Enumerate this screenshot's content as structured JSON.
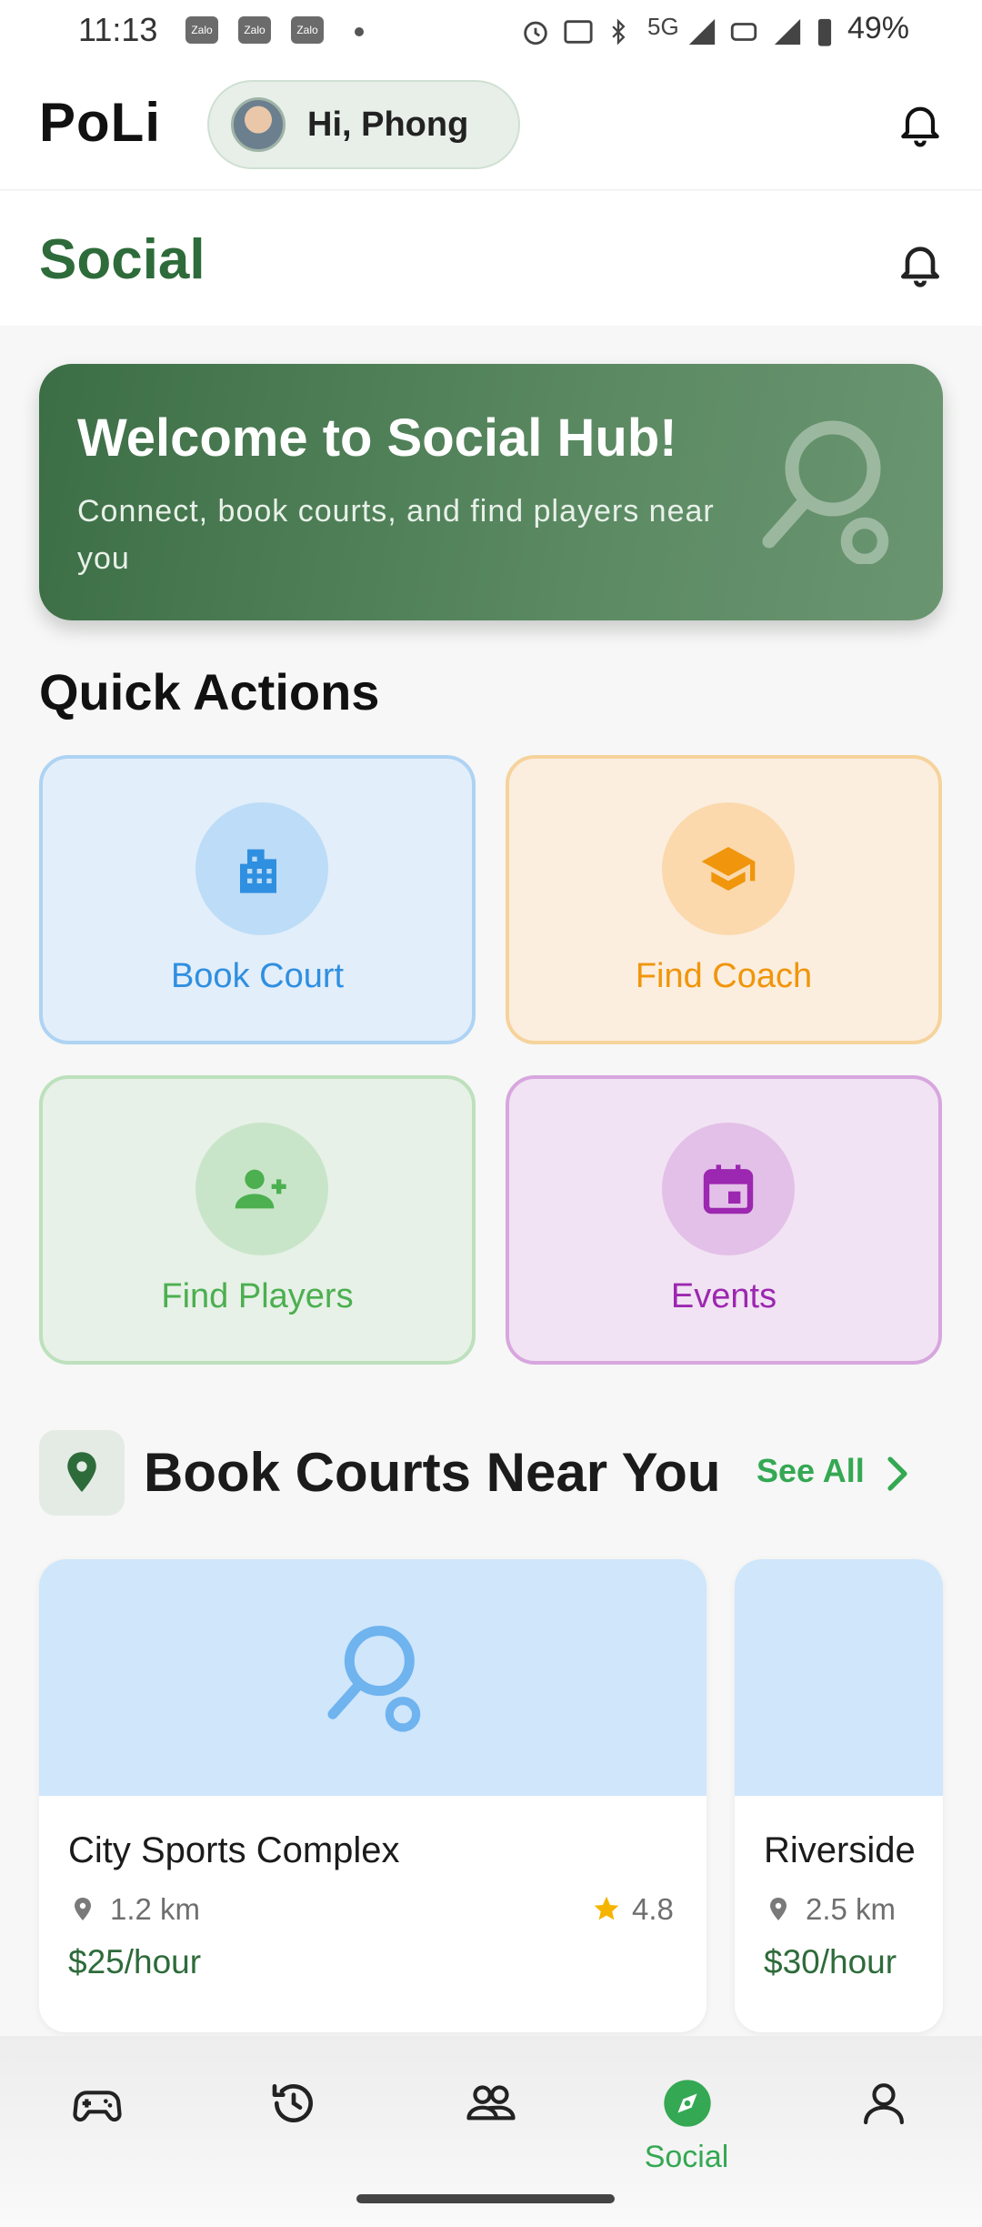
{
  "status_bar": {
    "time": "11:13",
    "notification_icons": [
      "Zalo",
      "Zalo",
      "Zalo"
    ],
    "battery": "49%",
    "network": "5G"
  },
  "header": {
    "logo": "PoLi",
    "greeting": "Hi, Phong"
  },
  "section": {
    "title": "Social"
  },
  "hero": {
    "title": "Welcome to Social Hub!",
    "subtitle": "Connect, book courts, and find players near you"
  },
  "quick_actions": {
    "title": "Quick Actions",
    "items": [
      {
        "label": "Book Court",
        "icon": "building-icon",
        "color": "#2f8fe0"
      },
      {
        "label": "Find Coach",
        "icon": "graduation-cap-icon",
        "color": "#f0950c"
      },
      {
        "label": "Find Players",
        "icon": "add-person-icon",
        "color": "#4caf50"
      },
      {
        "label": "Events",
        "icon": "calendar-icon",
        "color": "#9c27b0"
      }
    ]
  },
  "courts": {
    "title": "Book Courts Near You",
    "see_all": "See All",
    "items": [
      {
        "name": "City Sports Complex",
        "distance": "1.2 km",
        "rating": "4.8",
        "price": "$25/hour"
      },
      {
        "name": "Riverside",
        "distance": "2.5 km",
        "price": "$30/hour"
      }
    ]
  },
  "bottom_nav": {
    "items": [
      {
        "icon": "gamepad-icon"
      },
      {
        "icon": "history-icon"
      },
      {
        "icon": "people-icon"
      },
      {
        "icon": "compass-icon",
        "label": "Social",
        "active": true
      },
      {
        "icon": "profile-icon"
      }
    ],
    "active_color": "#34a853"
  }
}
